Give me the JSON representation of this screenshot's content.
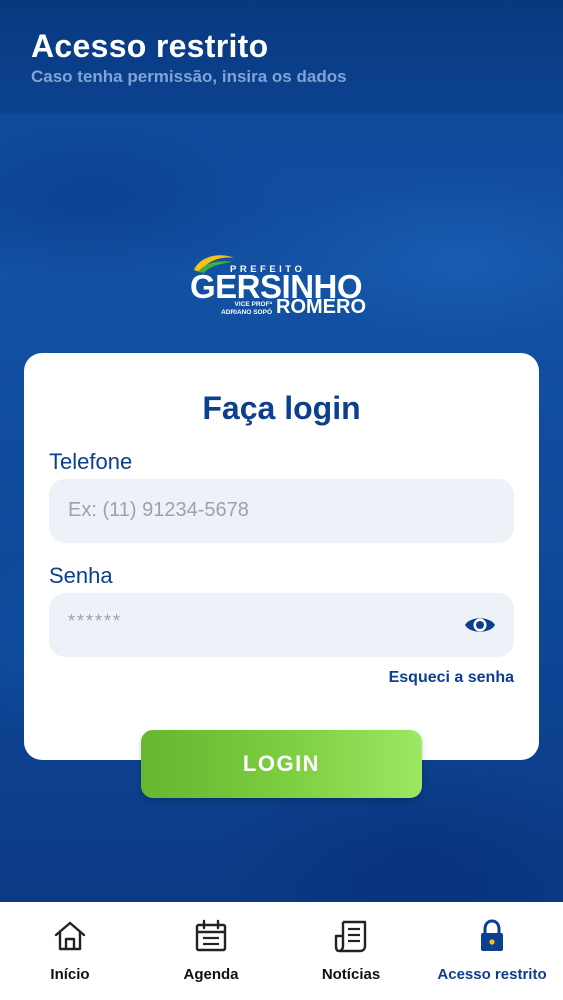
{
  "header": {
    "title": "Acesso restrito",
    "subtitle": "Caso tenha permissão, insira os dados"
  },
  "logo": {
    "prefeito": "PREFEITO",
    "gersinho": "GERSINHO",
    "vice_line1": "VICE PROFª",
    "vice_line2": "ADRIANO SOPÓ",
    "romero": "ROMERO"
  },
  "login": {
    "title": "Faça login",
    "phone_label": "Telefone",
    "phone_placeholder": "Ex: (11) 91234-5678",
    "password_label": "Senha",
    "password_placeholder": "******",
    "forgot_label": "Esqueci a senha",
    "button_label": "LOGIN"
  },
  "nav": {
    "items": [
      {
        "label": "Início",
        "icon": "home-icon",
        "active": false
      },
      {
        "label": "Agenda",
        "icon": "calendar-icon",
        "active": false
      },
      {
        "label": "Notícias",
        "icon": "news-icon",
        "active": false
      },
      {
        "label": "Acesso restrito",
        "icon": "lock-icon",
        "active": true
      }
    ]
  },
  "colors": {
    "brand_blue": "#0d3f8f",
    "button_green": "#7fcf43",
    "field_bg": "#eef1f7",
    "logo_yellow": "#f5c21b",
    "logo_green": "#3fae3a"
  }
}
